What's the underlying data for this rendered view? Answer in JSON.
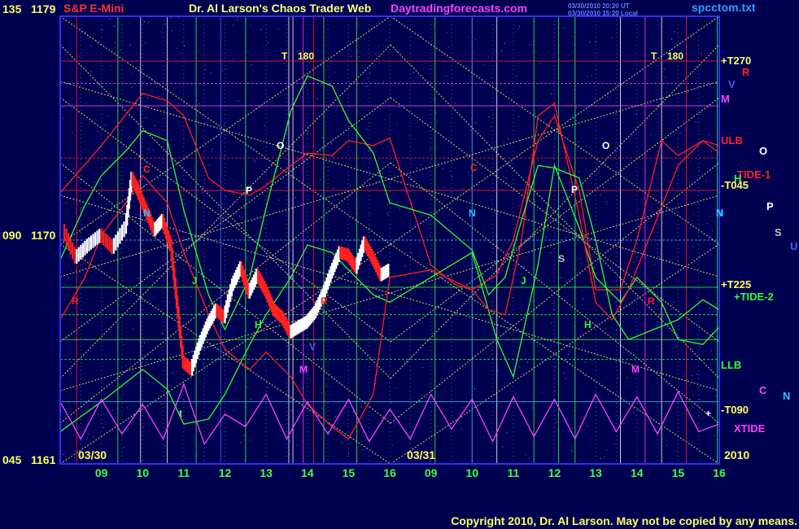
{
  "header": {
    "left_title": "S&P E-Mini",
    "center_title": "Dr. Al Larson's Chaos Trader Web",
    "site": "Daytradingforecasts.com",
    "stamp_line1": "03/30/2010 20:20 UT",
    "stamp_line2": "03/30/2010 15:20 Local",
    "file": "spcctom.txt"
  },
  "copyright": "Copyright 2010, Dr. Al Larson. May not be copied by any means.",
  "colors": {
    "background": "#000050",
    "frame": "#3030ff",
    "title": "#ffff80",
    "left_title": "#ff3030",
    "site": "#ff40ff",
    "file": "#30a0ff",
    "axis_label": "#ffff60",
    "time_label": "#40ff40",
    "price_up": "#ffffff",
    "price_down": "#ff2020",
    "magenta": "#ff40ff",
    "green": "#30ff30",
    "red": "#ff2020",
    "yellow_dot": "#ffff60"
  },
  "chart_data": {
    "type": "line",
    "title": "S&P E-Mini",
    "y_labels": [
      {
        "angle": "135",
        "price": "1179"
      },
      {
        "angle": "090",
        "price": "1170"
      },
      {
        "angle": "045",
        "price": "1161"
      }
    ],
    "ylim": [
      1161,
      1179
    ],
    "date_labels": [
      "03/30",
      "03/31"
    ],
    "year": "2010",
    "x_ticks": [
      "09",
      "10",
      "11",
      "12",
      "13",
      "14",
      "15",
      "16",
      "09",
      "10",
      "11",
      "12",
      "13",
      "14",
      "15",
      "16"
    ],
    "right_labels": [
      {
        "text": "+T270",
        "color": "#ffff60"
      },
      {
        "text": "R",
        "color": "#ff2020"
      },
      {
        "text": "V",
        "color": "#4060ff"
      },
      {
        "text": "M",
        "color": "#ff40ff"
      },
      {
        "text": "ULB",
        "color": "#ff2020"
      },
      {
        "text": "O",
        "color": "#ffffff"
      },
      {
        "text": "TIDE-1",
        "color": "#ff2020"
      },
      {
        "text": "H",
        "color": "#30ff30"
      },
      {
        "text": "-T045",
        "color": "#ffff60"
      },
      {
        "text": "N",
        "color": "#30c0ff"
      },
      {
        "text": "P",
        "color": "#ffffff"
      },
      {
        "text": "S",
        "color": "#c0c0c0"
      },
      {
        "text": "U",
        "color": "#4060ff"
      },
      {
        "text": "+T225",
        "color": "#ffff60"
      },
      {
        "text": "+TIDE-2",
        "color": "#30ff30"
      },
      {
        "text": "LLB",
        "color": "#30ff30"
      },
      {
        "text": "C",
        "color": "#ff40ff"
      },
      {
        "text": "N",
        "color": "#30c0ff"
      },
      {
        "text": "-T090",
        "color": "#ffff60"
      },
      {
        "text": "XTIDE",
        "color": "#ff40ff"
      }
    ],
    "in_chart_labels": [
      {
        "text": "T",
        "color": "#ffff60"
      },
      {
        "text": "180",
        "color": "#ffff60"
      },
      {
        "text": "T",
        "color": "#ffff60"
      },
      {
        "text": "180",
        "color": "#ffff60"
      },
      {
        "text": "O",
        "color": "#ffffff"
      },
      {
        "text": "O",
        "color": "#ffffff"
      },
      {
        "text": "C",
        "color": "#ff2020"
      },
      {
        "text": "C",
        "color": "#ff2020"
      },
      {
        "text": "P",
        "color": "#ffffff"
      },
      {
        "text": "P",
        "color": "#ffffff"
      },
      {
        "text": "N",
        "color": "#30c0ff"
      },
      {
        "text": "N",
        "color": "#30c0ff"
      },
      {
        "text": "N",
        "color": "#30c0ff"
      },
      {
        "text": "J",
        "color": "#30ff30"
      },
      {
        "text": "J",
        "color": "#30ff30"
      },
      {
        "text": "H",
        "color": "#30ff30"
      },
      {
        "text": "H",
        "color": "#30ff30"
      },
      {
        "text": "S",
        "color": "#c0c0c0"
      },
      {
        "text": "V",
        "color": "#4060ff"
      },
      {
        "text": "M",
        "color": "#ff40ff"
      },
      {
        "text": "M",
        "color": "#ff40ff"
      },
      {
        "text": "R",
        "color": "#ff2020"
      },
      {
        "text": "R",
        "color": "#ff2020"
      },
      {
        "text": "R",
        "color": "#ff2020"
      },
      {
        "text": "t",
        "color": "#c0c0c0"
      },
      {
        "text": "+",
        "color": "#ffffff"
      }
    ],
    "series": [
      {
        "name": "price",
        "x": [
          8.1,
          8.4,
          8.7,
          9.0,
          9.3,
          9.6,
          9.75,
          9.9,
          10.1,
          10.3,
          10.5,
          10.7,
          10.85,
          11.0,
          11.2,
          11.4,
          11.6,
          11.8,
          12.0,
          12.2,
          12.4,
          12.6,
          12.8,
          13.0,
          13.2,
          13.4,
          13.6,
          13.8,
          14.0,
          14.2,
          14.4,
          14.6,
          14.8,
          15.0,
          15.2,
          15.4,
          15.6,
          15.8,
          16.0
        ],
        "values": [
          1170.4,
          1169.3,
          1169.8,
          1170.2,
          1169.7,
          1170.5,
          1172.5,
          1172.0,
          1171.2,
          1170.4,
          1170.8,
          1169.8,
          1167.5,
          1165.1,
          1164.8,
          1165.8,
          1166.6,
          1167.2,
          1166.9,
          1168.2,
          1168.9,
          1167.9,
          1168.6,
          1168.0,
          1167.2,
          1166.9,
          1166.3,
          1166.5,
          1166.7,
          1167.1,
          1167.8,
          1168.7,
          1169.5,
          1169.4,
          1168.9,
          1169.9,
          1169.3,
          1168.6,
          1168.8
        ]
      },
      {
        "name": "ULB",
        "x": [
          8.0,
          9.0,
          10.0,
          10.6,
          11.0,
          11.6,
          12.0,
          12.6,
          13.0,
          13.6,
          14.0,
          14.6,
          15.0,
          15.6,
          16.0,
          17.0,
          17.6,
          18.0,
          18.6,
          19.0,
          19.6,
          20.0,
          20.6,
          21.0,
          21.6,
          22.0,
          22.6,
          23.0,
          23.6,
          24.0
        ],
        "values": [
          1171.9,
          1173.8,
          1175.9,
          1175.6,
          1175.0,
          1172.5,
          1172.0,
          1171.8,
          1172.2,
          1173.0,
          1173.5,
          1173.4,
          1174.0,
          1173.8,
          1174.1,
          1169.0,
          1168.2,
          1168.0,
          1168.6,
          1170.0,
          1174.0,
          1175.0,
          1172.0,
          1168.0,
          1168.0,
          1170.0,
          1174.0,
          1173.4,
          1174.0,
          1173.8
        ]
      },
      {
        "name": "LLB",
        "x": [
          8.0,
          9.0,
          10.0,
          10.6,
          11.0,
          11.6,
          12.0,
          12.6,
          13.0,
          13.6,
          14.0,
          14.6,
          15.0,
          15.6,
          16.0,
          17.0,
          18.0,
          18.6,
          19.0,
          19.6,
          20.0,
          20.6,
          21.0,
          21.6,
          22.0,
          22.6,
          23.0,
          23.6,
          24.0
        ],
        "values": [
          1162.3,
          1163.5,
          1164.8,
          1164.0,
          1162.6,
          1162.8,
          1163.8,
          1165.8,
          1167.0,
          1168.5,
          1169.8,
          1169.5,
          1168.8,
          1167.8,
          1167.5,
          1168.5,
          1169.5,
          1166.0,
          1164.5,
          1169.0,
          1173.0,
          1170.5,
          1168.5,
          1167.5,
          1168.5,
          1167.5,
          1166.0,
          1165.8,
          1166.5
        ]
      },
      {
        "name": "TIDE-1",
        "x": [
          8.0,
          8.6,
          9.0,
          9.6,
          10.0,
          10.6,
          11.0,
          11.6,
          12.0,
          12.6,
          13.0,
          13.6,
          14.0,
          14.6,
          15.0,
          15.6,
          16.0,
          17.0,
          18.0,
          18.4,
          18.8,
          19.2,
          19.6,
          20.0,
          20.6,
          21.0,
          21.4,
          21.8,
          22.4,
          23.0,
          23.6,
          24.0
        ],
        "values": [
          1166.8,
          1168.5,
          1170.2,
          1171.5,
          1172.6,
          1171.5,
          1169.5,
          1167.0,
          1165.6,
          1164.8,
          1165.5,
          1164.5,
          1163.4,
          1162.5,
          1162.0,
          1163.8,
          1168.5,
          1168.8,
          1168.0,
          1167.2,
          1167.0,
          1170.0,
          1175.0,
          1175.5,
          1171.0,
          1167.5,
          1166.8,
          1168.0,
          1170.5,
          1173.0,
          1174.0,
          1173.5
        ]
      },
      {
        "name": "TIDE-2",
        "x": [
          8.0,
          8.6,
          9.0,
          9.6,
          10.0,
          10.6,
          11.0,
          11.6,
          12.0,
          12.6,
          13.0,
          13.6,
          14.0,
          14.6,
          15.0,
          15.6,
          16.0,
          17.0,
          18.0,
          18.4,
          18.8,
          19.2,
          19.6,
          20.0,
          20.6,
          21.0,
          21.4,
          21.8,
          22.4,
          23.0,
          23.6,
          24.0
        ],
        "values": [
          1169.2,
          1171.4,
          1172.6,
          1173.6,
          1174.4,
          1174.0,
          1171.2,
          1167.8,
          1166.4,
          1168.5,
          1171.3,
          1175.2,
          1176.6,
          1176.2,
          1174.8,
          1173.5,
          1171.5,
          1171.0,
          1169.6,
          1167.8,
          1168.5,
          1170.8,
          1173.0,
          1172.9,
          1172.5,
          1170.0,
          1167.0,
          1166.0,
          1166.4,
          1166.8,
          1167.6,
          1167.2
        ]
      },
      {
        "name": "XTIDE",
        "x": [
          8.0,
          8.5,
          9.0,
          9.5,
          10.0,
          10.5,
          11.0,
          11.5,
          12.0,
          12.5,
          13.0,
          13.5,
          14.0,
          14.5,
          15.0,
          15.5,
          16.0,
          16.5,
          17.0,
          17.5,
          18.0,
          18.5,
          19.0,
          19.5,
          20.0,
          20.5,
          21.0,
          21.5,
          22.0,
          22.5,
          23.0,
          23.5,
          24.0
        ],
        "values": [
          1163.5,
          1162.0,
          1163.6,
          1162.2,
          1163.4,
          1162.0,
          1164.2,
          1161.8,
          1163.0,
          1162.5,
          1163.8,
          1162.0,
          1163.5,
          1162.2,
          1163.6,
          1161.9,
          1163.2,
          1162.0,
          1163.8,
          1162.4,
          1163.6,
          1161.9,
          1163.7,
          1162.1,
          1163.6,
          1162.0,
          1163.8,
          1162.3,
          1163.7,
          1162.2,
          1163.9,
          1162.3,
          1162.6
        ]
      }
    ],
    "horizontal_levels": [
      1177.2,
      1176.3,
      1175.4,
      1173.3,
      1172.0,
      1170.0,
      1168.1,
      1167.0,
      1166.0,
      1165.2,
      1163.5
    ],
    "vertical_lines": [
      8.4,
      9.4,
      9.95,
      10.6,
      11.3,
      11.9,
      12.5,
      13.55,
      13.65,
      13.9,
      14.15,
      14.4,
      15.2,
      17.1,
      18.0,
      18.6,
      19.5,
      20.1,
      20.5,
      21.6,
      22.2,
      22.6,
      23.2,
      23.95
    ],
    "grid": true,
    "legend": "right"
  }
}
